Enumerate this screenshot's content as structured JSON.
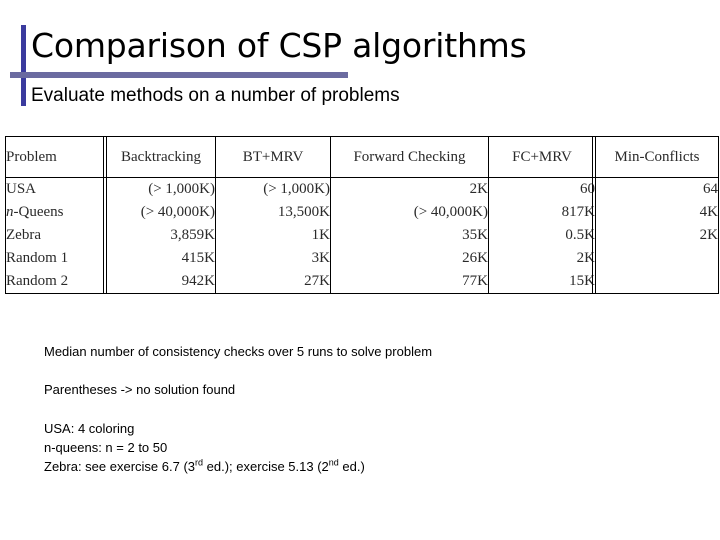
{
  "slide": {
    "title": "Comparison of CSP algorithms",
    "subtitle": "Evaluate methods on a number of problems",
    "accent_bar_color": "#3b3b9e",
    "accent_rule_color": "#6b6ba0"
  },
  "table": {
    "columns": [
      "Problem",
      "Backtracking",
      "BT+MRV",
      "Forward Checking",
      "FC+MRV",
      "Min-Conflicts"
    ],
    "rows": [
      {
        "problem": "USA",
        "problem_italic_prefix": "",
        "backtracking": "(> 1,000K)",
        "bt_mrv": "(> 1,000K)",
        "forward_checking": "2K",
        "fc_mrv": "60",
        "min_conflicts": "64"
      },
      {
        "problem": "-Queens",
        "problem_italic_prefix": "n",
        "backtracking": "(> 40,000K)",
        "bt_mrv": "13,500K",
        "forward_checking": "(> 40,000K)",
        "fc_mrv": "817K",
        "min_conflicts": "4K"
      },
      {
        "problem": "Zebra",
        "problem_italic_prefix": "",
        "backtracking": "3,859K",
        "bt_mrv": "1K",
        "forward_checking": "35K",
        "fc_mrv": "0.5K",
        "min_conflicts": "2K"
      },
      {
        "problem": "Random 1",
        "problem_italic_prefix": "",
        "backtracking": "415K",
        "bt_mrv": "3K",
        "forward_checking": "26K",
        "fc_mrv": "2K",
        "min_conflicts": ""
      },
      {
        "problem": "Random 2",
        "problem_italic_prefix": "",
        "backtracking": "942K",
        "bt_mrv": "27K",
        "forward_checking": "77K",
        "fc_mrv": "15K",
        "min_conflicts": ""
      }
    ]
  },
  "notes": {
    "median": "Median number of consistency checks over 5 runs to solve problem",
    "parentheses": "Parentheses -> no solution found",
    "usa": "USA: 4 coloring",
    "nqueens": "n-queens: n = 2 to 50",
    "zebra_prefix": "Zebra: see exercise 6.7 (3",
    "zebra_sup1": "rd",
    "zebra_mid": " ed.); exercise 5.13 (2",
    "zebra_sup2": "nd",
    "zebra_suffix": " ed.)"
  }
}
